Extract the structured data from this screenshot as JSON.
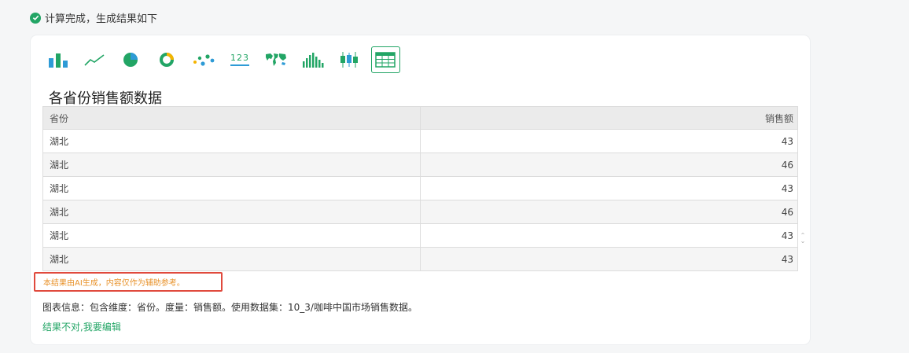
{
  "status": {
    "text": "计算完成，生成结果如下"
  },
  "toolbar": {
    "tools": [
      {
        "icon": "bar-chart-icon"
      },
      {
        "icon": "line-chart-icon"
      },
      {
        "icon": "pie-chart-icon"
      },
      {
        "icon": "donut-chart-icon"
      },
      {
        "icon": "scatter-chart-icon"
      },
      {
        "icon": "number-card-icon",
        "label": "123"
      },
      {
        "icon": "map-chart-icon"
      },
      {
        "icon": "histogram-chart-icon"
      },
      {
        "icon": "candlestick-chart-icon"
      },
      {
        "icon": "table-chart-icon",
        "active": true
      }
    ]
  },
  "chart": {
    "title": "各省份销售额数据",
    "columns": [
      "省份",
      "销售额"
    ],
    "rows": [
      [
        "湖北",
        "43"
      ],
      [
        "湖北",
        "46"
      ],
      [
        "湖北",
        "43"
      ],
      [
        "湖北",
        "46"
      ],
      [
        "湖北",
        "43"
      ],
      [
        "湖北",
        "43"
      ]
    ]
  },
  "ai_note": "本结果由AI生成，内容仅作为辅助参考。",
  "info": "图表信息：包含维度：省份。度量：销售额。使用数据集：10_3/咖啡中国市场销售数据。",
  "edit_link": "结果不对,我要编辑",
  "colors": {
    "accent": "#22a565",
    "note_border": "#e04a3d",
    "note_text": "#e8922a"
  }
}
